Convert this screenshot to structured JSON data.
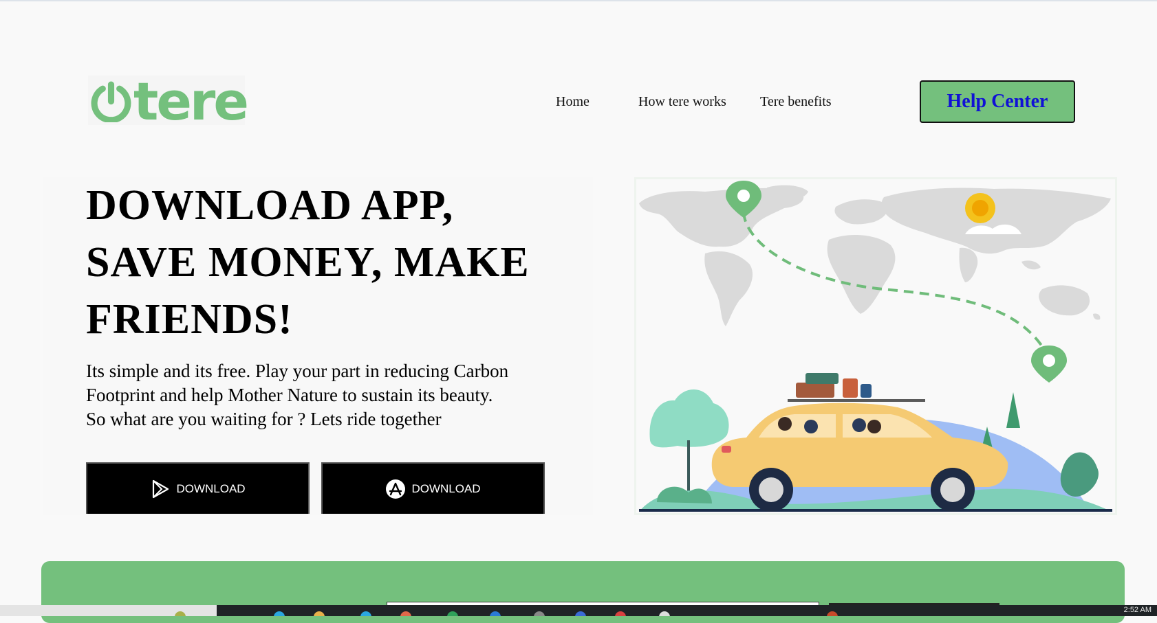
{
  "brand": {
    "name": "tere",
    "logo_color": "#74c07d"
  },
  "nav": {
    "items": [
      {
        "label": "Home"
      },
      {
        "label": "How tere works"
      },
      {
        "label": "Tere benefits"
      }
    ],
    "help_label": "Help Center"
  },
  "hero": {
    "title_lines": [
      "DOWNLOAD APP,",
      "SAVE MONEY, MAKE",
      "FRIENDS!"
    ],
    "description_lines": [
      "Its simple and its free. Play your part in reducing Carbon",
      "Footprint and help Mother Nature to sustain its beauty.",
      "So what are you waiting for ? Lets ride together"
    ],
    "download_buttons": [
      {
        "label": "DOWNLOAD",
        "icon": "play-store-icon"
      },
      {
        "label": "DOWNLOAD",
        "icon": "app-store-icon"
      }
    ],
    "illustration": "world-map-road-trip"
  },
  "taskbar": {
    "time": "2:52 AM"
  },
  "colors": {
    "accent_green": "#74c07d",
    "help_text_blue": "#1010d6",
    "button_black": "#000000"
  }
}
